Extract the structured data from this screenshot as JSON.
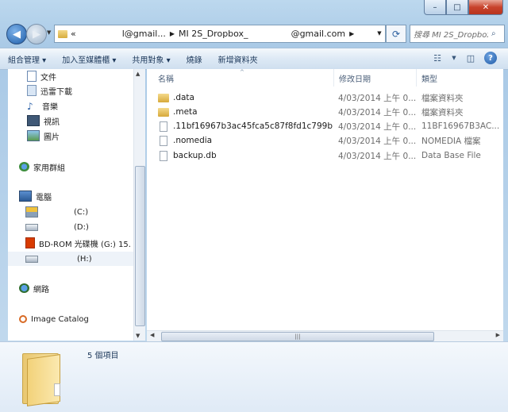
{
  "window": {
    "caption": {
      "minimize": "–",
      "maximize": "□",
      "close": "✕"
    }
  },
  "address": {
    "crumb_prefix": "«",
    "crumb1": "l@gmail...",
    "crumb2": "MI 2S_Dropbox_",
    "crumb3": "@gmail.com",
    "search_placeholder": "搜尋 MI 2S_Dropbox_..."
  },
  "toolbar": {
    "organize": "組合管理 ▾",
    "add_to_library": "加入至媒體櫃 ▾",
    "share": "共用對象 ▾",
    "burn": "燒錄",
    "new_folder": "新增資料夾"
  },
  "nav": {
    "items": [
      {
        "label": "文件",
        "icon": "document-icon"
      },
      {
        "label": "迅雷下載",
        "icon": "download-icon"
      },
      {
        "label": "音樂",
        "icon": "music-icon"
      },
      {
        "label": "視訊",
        "icon": "video-icon"
      },
      {
        "label": "圖片",
        "icon": "picture-icon"
      },
      {
        "label": "家用群組",
        "icon": "homegroup-icon"
      },
      {
        "label": "電腦",
        "icon": "computer-icon"
      },
      {
        "label": "(C:)",
        "icon": "drive-c-icon"
      },
      {
        "label": "(D:)",
        "icon": "drive-icon"
      },
      {
        "label": "BD-ROM 光碟機 (G:) 15.",
        "icon": "office-icon"
      },
      {
        "label": "(H:)",
        "icon": "drive-icon"
      },
      {
        "label": "網路",
        "icon": "network-icon"
      },
      {
        "label": "Image Catalog",
        "icon": "catalog-icon"
      }
    ]
  },
  "columns": {
    "name": "名稱",
    "date": "修改日期",
    "type": "類型"
  },
  "files": [
    {
      "name": ".data",
      "date": "4/03/2014 上午 0...",
      "type": "檔案資料夾",
      "kind": "folder"
    },
    {
      "name": ".meta",
      "date": "4/03/2014 上午 0...",
      "type": "檔案資料夾",
      "kind": "folder"
    },
    {
      "name": ".11bf16967b3ac45fca5c87f8fd1c799b",
      "date": "4/03/2014 上午 0...",
      "type": "11BF16967B3AC...",
      "kind": "file"
    },
    {
      "name": ".nomedia",
      "date": "4/03/2014 上午 0...",
      "type": "NOMEDIA 檔案",
      "kind": "file"
    },
    {
      "name": "backup.db",
      "date": "4/03/2014 上午 0...",
      "type": "Data Base File",
      "kind": "file"
    }
  ],
  "status": {
    "item_count": "5 個項目"
  }
}
